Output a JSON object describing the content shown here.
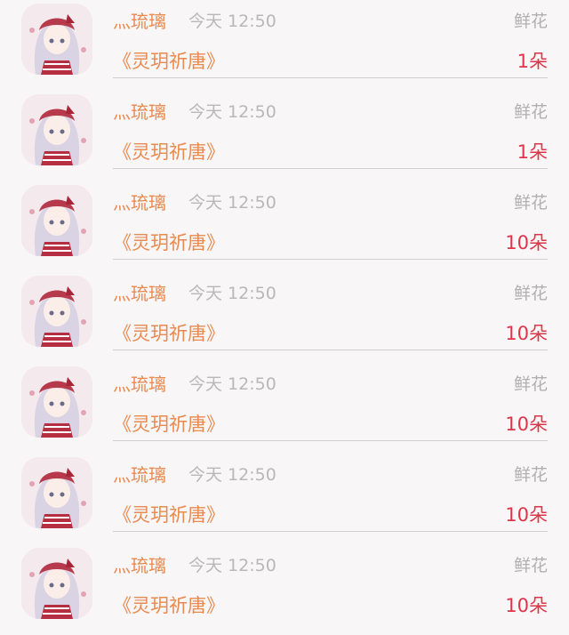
{
  "colors": {
    "background": "#f8f6f7",
    "accent_orange": "#e98a51",
    "amount_red": "#e0344a",
    "muted_gray": "#b8b8b8",
    "divider": "#cfcfcf"
  },
  "gift_records": [
    {
      "avatar_icon": "anime-girl-avatar",
      "username": "灬琉璃",
      "time": "今天 12:50",
      "gift_type": "鲜花",
      "work_title": "《灵玥祈唐》",
      "amount": "1朵"
    },
    {
      "avatar_icon": "anime-girl-avatar",
      "username": "灬琉璃",
      "time": "今天 12:50",
      "gift_type": "鲜花",
      "work_title": "《灵玥祈唐》",
      "amount": "1朵"
    },
    {
      "avatar_icon": "anime-girl-avatar",
      "username": "灬琉璃",
      "time": "今天 12:50",
      "gift_type": "鲜花",
      "work_title": "《灵玥祈唐》",
      "amount": "10朵"
    },
    {
      "avatar_icon": "anime-girl-avatar",
      "username": "灬琉璃",
      "time": "今天 12:50",
      "gift_type": "鲜花",
      "work_title": "《灵玥祈唐》",
      "amount": "10朵"
    },
    {
      "avatar_icon": "anime-girl-avatar",
      "username": "灬琉璃",
      "time": "今天 12:50",
      "gift_type": "鲜花",
      "work_title": "《灵玥祈唐》",
      "amount": "10朵"
    },
    {
      "avatar_icon": "anime-girl-avatar",
      "username": "灬琉璃",
      "time": "今天 12:50",
      "gift_type": "鲜花",
      "work_title": "《灵玥祈唐》",
      "amount": "10朵"
    },
    {
      "avatar_icon": "anime-girl-avatar",
      "username": "灬琉璃",
      "time": "今天 12:50",
      "gift_type": "鲜花",
      "work_title": "《灵玥祈唐》",
      "amount": "10朵"
    }
  ]
}
